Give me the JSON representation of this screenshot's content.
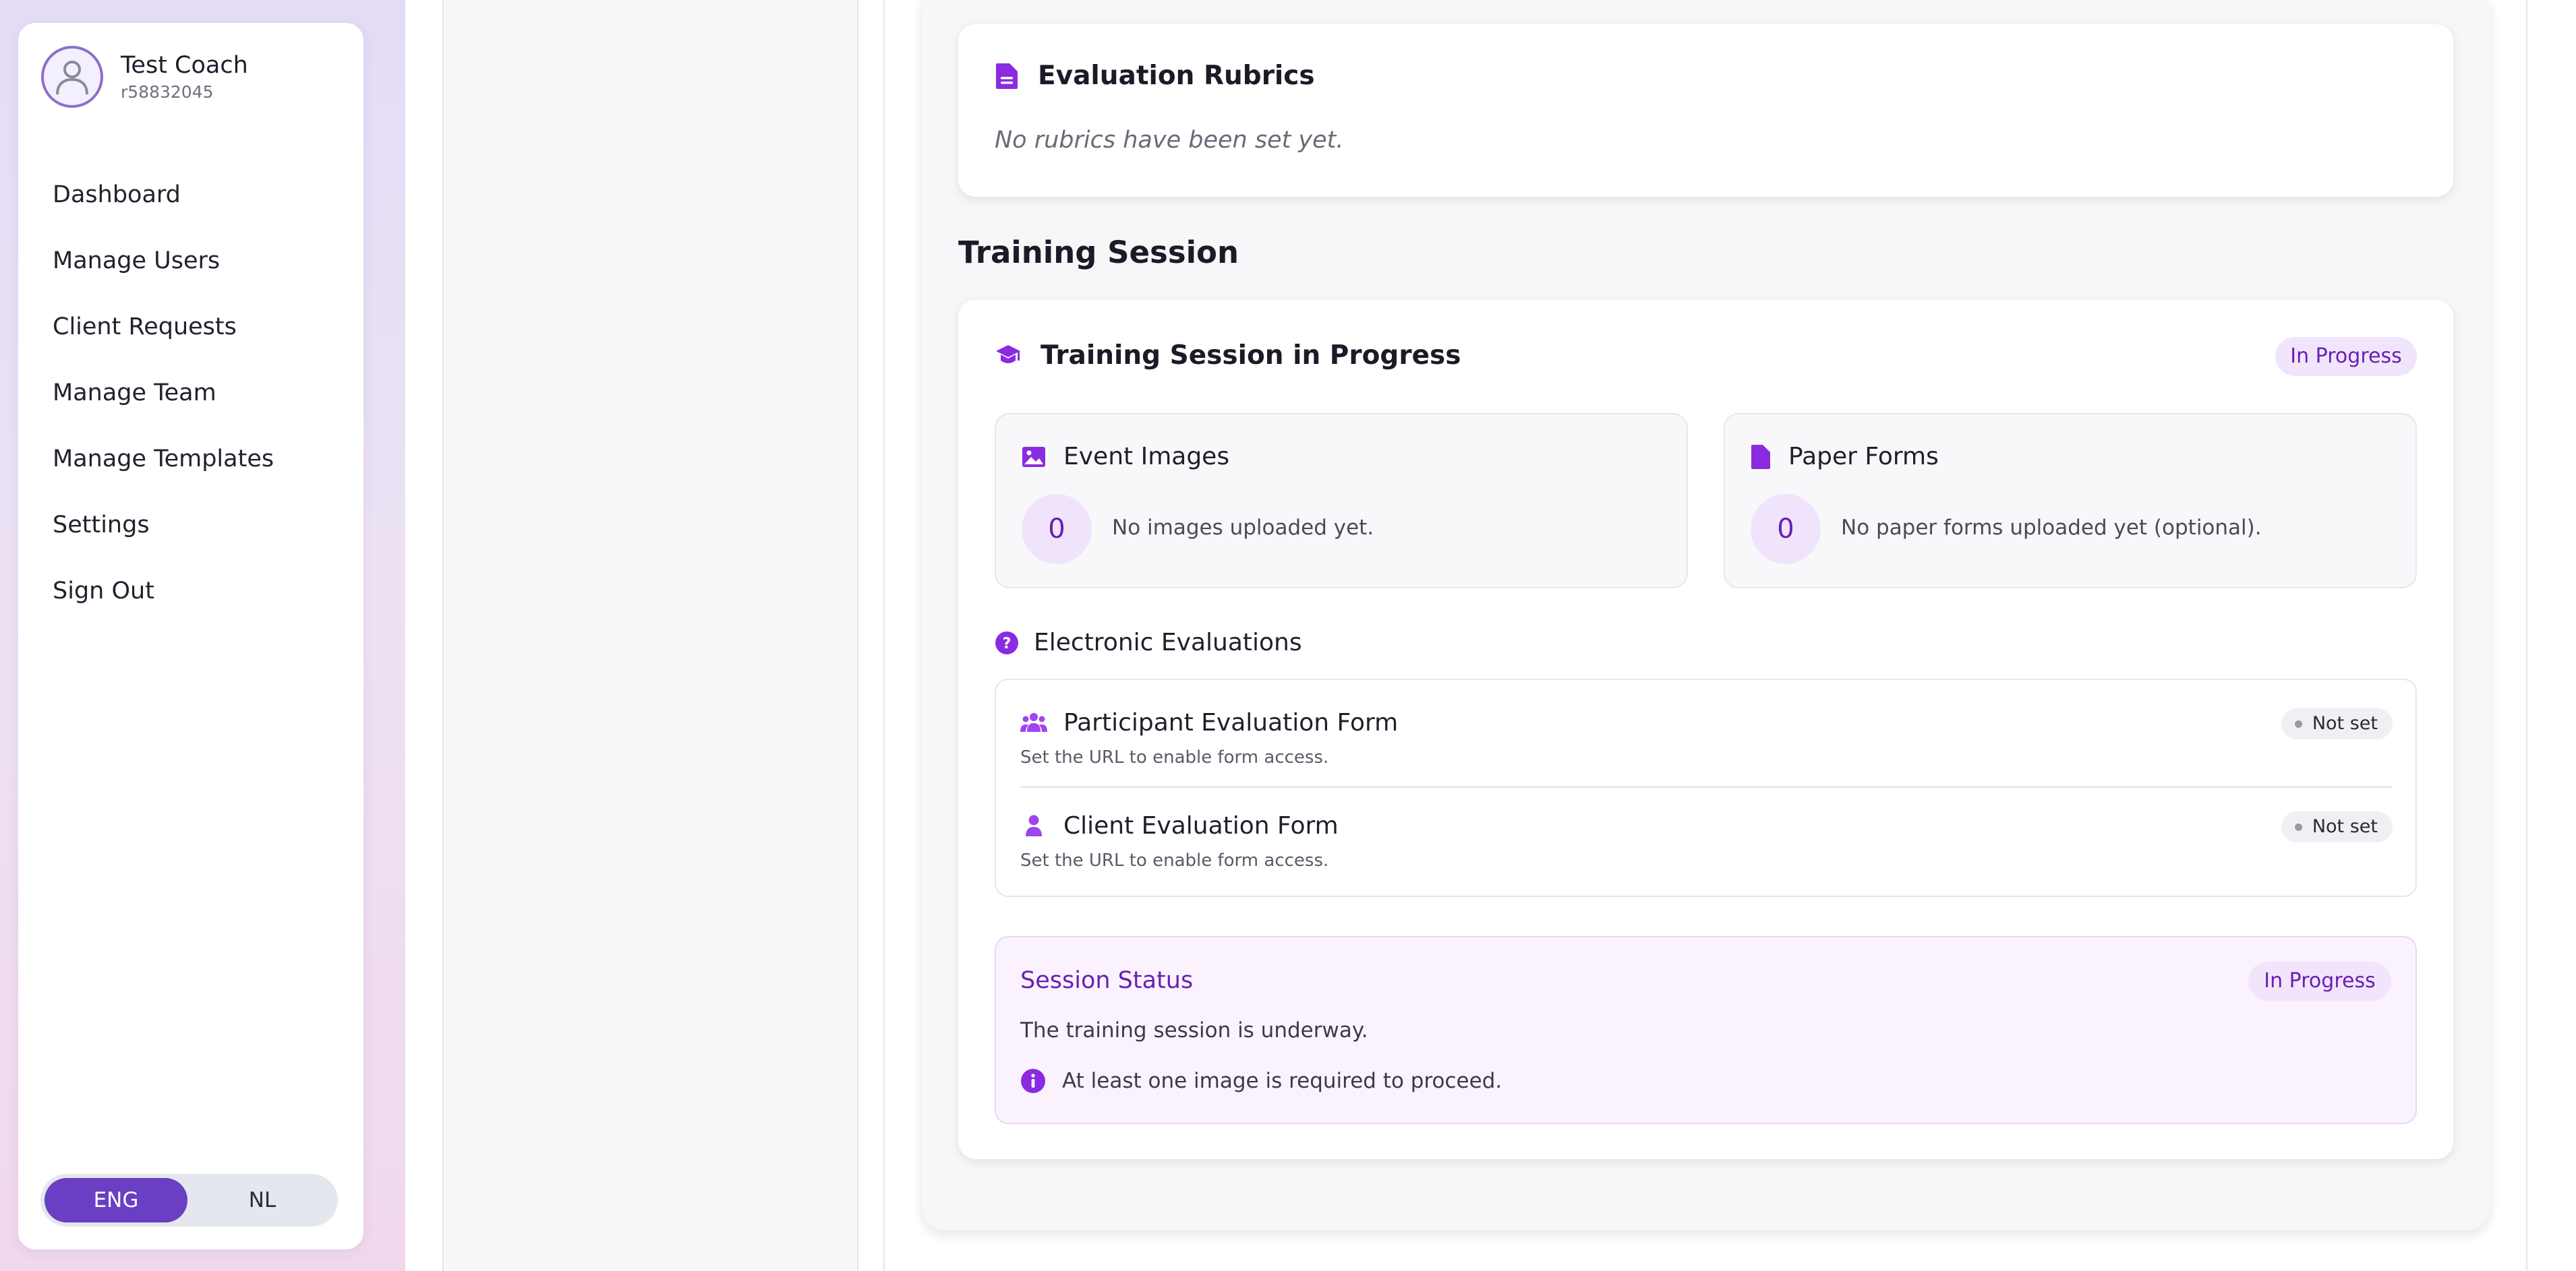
{
  "user": {
    "name": "Test Coach",
    "id": "r58832045"
  },
  "nav": {
    "items": [
      {
        "label": "Dashboard"
      },
      {
        "label": "Manage Users"
      },
      {
        "label": "Client Requests"
      },
      {
        "label": "Manage Team"
      },
      {
        "label": "Manage Templates"
      },
      {
        "label": "Settings"
      },
      {
        "label": "Sign Out"
      }
    ]
  },
  "language": {
    "selected": "ENG",
    "eng_label": "ENG",
    "nl_label": "NL"
  },
  "rubrics": {
    "title": "Evaluation Rubrics",
    "empty_text": "No rubrics have been set yet."
  },
  "training": {
    "section_title": "Training Session",
    "card_title": "Training Session in Progress",
    "status_badge": "In Progress",
    "event_images": {
      "title": "Event Images",
      "count": "0",
      "text": "No images uploaded yet."
    },
    "paper_forms": {
      "title": "Paper Forms",
      "count": "0",
      "text": "No paper forms uploaded yet (optional)."
    },
    "electronic": {
      "title": "Electronic Evaluations",
      "forms": [
        {
          "label": "Participant Evaluation Form",
          "hint": "Set the URL to enable form access.",
          "status": "Not set"
        },
        {
          "label": "Client Evaluation Form",
          "hint": "Set the URL to enable form access.",
          "status": "Not set"
        }
      ]
    },
    "session_status": {
      "title": "Session Status",
      "badge": "In Progress",
      "text": "The training session is underway.",
      "note": "At least one image is required to proceed."
    }
  },
  "colors": {
    "accent_purple": "#7b2fd0",
    "brand_purple": "#6a3fc3",
    "badge_bg": "#f1e5fc"
  },
  "icons": {
    "avatar": "user-avatar-icon",
    "rubrics": "document-icon",
    "training": "graduation-cap-icon",
    "images": "image-icon",
    "paper": "file-icon",
    "electronic": "question-circle-icon",
    "participant": "users-icon",
    "client": "user-icon",
    "note": "info-circle-icon"
  }
}
